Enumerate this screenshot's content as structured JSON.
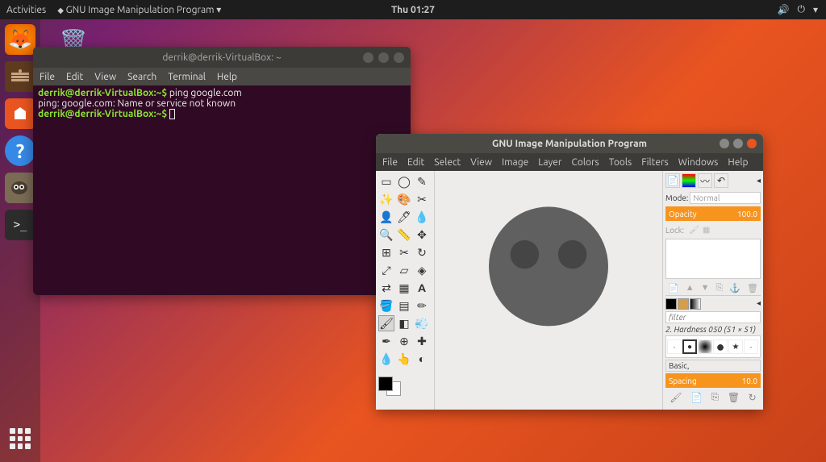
{
  "topbar": {
    "activities": "Activities",
    "app_indicator": "GNU Image Manipulation Program ▾",
    "clock": "Thu 01:27"
  },
  "dock": {
    "items": [
      "firefox",
      "files",
      "software",
      "help",
      "gimp",
      "terminal"
    ]
  },
  "terminal": {
    "title": "derrik@derrik-VirtualBox: ~",
    "menu": [
      "File",
      "Edit",
      "View",
      "Search",
      "Terminal",
      "Help"
    ],
    "lines": [
      {
        "prompt": "derrik@derrik-VirtualBox:~$",
        "cmd": "ping google.com"
      },
      {
        "text": "ping: google.com: Name or service not known"
      },
      {
        "prompt": "derrik@derrik-VirtualBox:~$",
        "cmd": ""
      }
    ]
  },
  "gimp": {
    "title": "GNU Image Manipulation Program",
    "menu": [
      "File",
      "Edit",
      "Select",
      "View",
      "Image",
      "Layer",
      "Colors",
      "Tools",
      "Filters",
      "Windows",
      "Help"
    ],
    "mode_label": "Mode:",
    "mode_value": "Normal",
    "opacity_label": "Opacity",
    "opacity_value": "100.0",
    "lock_label": "Lock:",
    "filter_placeholder": "filter",
    "brush_name": "2. Hardness 050 (51 × 51)",
    "basic_label": "Basic,",
    "spacing_label": "Spacing",
    "spacing_value": "10.0"
  }
}
